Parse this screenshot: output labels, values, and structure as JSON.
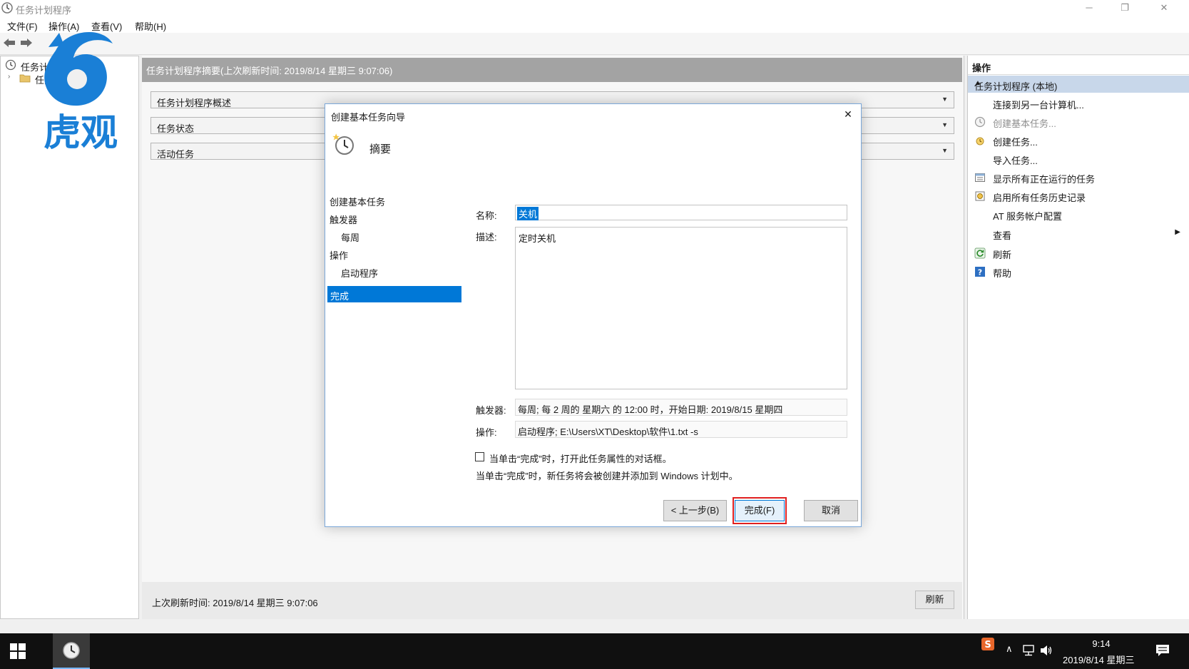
{
  "window": {
    "title": "任务计划程序"
  },
  "menu": [
    "文件(F)",
    "操作(A)",
    "查看(V)",
    "帮助(H)"
  ],
  "tree": {
    "root": "任务计划程序 (本地)",
    "child": "任务计划程序库"
  },
  "center": {
    "summary_header": "任务计划程序摘要(上次刷新时间: 2019/8/14 星期三 9:07:06)",
    "sections": [
      "任务计划程序概述",
      "任务状态",
      "活动任务"
    ],
    "last_refresh": "上次刷新时间: 2019/8/14 星期三 9:07:06",
    "refresh_button": "刷新"
  },
  "actions": {
    "header": "操作",
    "group": "任务计划程序 (本地)",
    "items": [
      {
        "label": "连接到另一台计算机...",
        "icon": "none",
        "enabled": true
      },
      {
        "label": "创建基本任务...",
        "icon": "clock-icon",
        "enabled": false
      },
      {
        "label": "创建任务...",
        "icon": "new-task-icon",
        "enabled": true
      },
      {
        "label": "导入任务...",
        "icon": "none",
        "enabled": true
      },
      {
        "label": "显示所有正在运行的任务",
        "icon": "running-tasks-icon",
        "enabled": true
      },
      {
        "label": "启用所有任务历史记录",
        "icon": "history-icon",
        "enabled": true
      },
      {
        "label": "AT 服务帐户配置",
        "icon": "none",
        "enabled": true
      },
      {
        "label": "查看",
        "icon": "none",
        "enabled": true
      },
      {
        "label": "刷新",
        "icon": "refresh-icon",
        "enabled": true
      },
      {
        "label": "帮助",
        "icon": "help-icon",
        "enabled": true
      }
    ]
  },
  "dialog": {
    "title": "创建基本任务向导",
    "close": "✕",
    "heading": "摘要",
    "steps": [
      {
        "label": "创建基本任务",
        "sub": false
      },
      {
        "label": "触发器",
        "sub": false
      },
      {
        "label": "每周",
        "sub": true
      },
      {
        "label": "操作",
        "sub": false
      },
      {
        "label": "启动程序",
        "sub": true
      }
    ],
    "active_step": "完成",
    "name_label": "名称:",
    "name_value": "关机",
    "desc_label": "描述:",
    "desc_value": "定时关机",
    "trigger_label": "触发器:",
    "trigger_value": "每周; 每 2 周的 星期六 的 12:00 时，开始日期: 2019/8/15 星期四",
    "action_label": "操作:",
    "action_value": "启动程序; E:\\Users\\XT\\Desktop\\软件\\1.txt -s",
    "checkbox_label": "当单击“完成”时，打开此任务属性的对话框。",
    "checkbox_checked": false,
    "info_text": "当单击“完成”时，新任务将会被创建并添加到 Windows 计划中。",
    "back_button": "< 上一步(B)",
    "finish_button": "完成(F)",
    "cancel_button": "取消"
  },
  "watermark": {
    "text": "虎观",
    "color": "#1a7fd6"
  },
  "taskbar": {
    "time": "9:14",
    "date": "2019/8/14 星期三"
  },
  "colors": {
    "accent": "#0078d7",
    "highlight": "#e02020",
    "group_bg": "#c8d7ea"
  }
}
